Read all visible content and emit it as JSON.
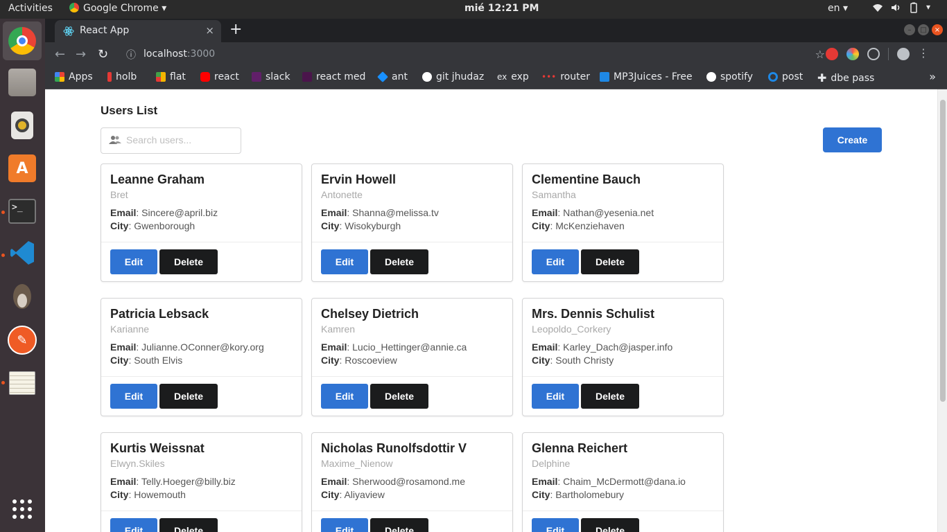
{
  "system": {
    "activities": "Activities",
    "app_menu": "Google Chrome",
    "clock": "mié 12:21 PM",
    "language": "en"
  },
  "dock": {
    "items": [
      "chrome-icon",
      "files-icon",
      "rhythmbox-icon",
      "software-center-icon",
      "terminal-icon",
      "vscode-icon",
      "gimp-icon",
      "postman-icon",
      "text-editor-icon",
      "show-apps-icon"
    ]
  },
  "browser": {
    "tab_title": "React App",
    "tab_close": "×",
    "new_tab": "+",
    "url_host": "localhost",
    "url_port": ":3000",
    "bookmarks": [
      "Apps",
      "holb",
      "flat",
      "react",
      "slack",
      "react med",
      "ant",
      "git jhudaz",
      "exp",
      "router",
      "MP3Juices - Free",
      "spotify",
      "post",
      "dbe pass"
    ],
    "bookmark_more": "»",
    "bookmark_colors": [
      "#ea4335",
      "#e53935",
      "#f4b400",
      "#ff0000",
      "#611f69",
      "#4a154b",
      "#1890ff",
      "#ffffff",
      "#9e9e9e",
      "#e53935",
      "#1e88e5",
      "#ffffff",
      "#1e88e5",
      "#ffffff"
    ]
  },
  "page": {
    "title": "Users List",
    "search_placeholder": "Search users...",
    "create_label": "Create",
    "edit_label": "Edit",
    "delete_label": "Delete",
    "email_label": "Email",
    "city_label": "City",
    "accent_color": "#2f73d3",
    "users": [
      {
        "name": "Leanne Graham",
        "username": "Bret",
        "email": "Sincere@april.biz",
        "city": "Gwenborough"
      },
      {
        "name": "Ervin Howell",
        "username": "Antonette",
        "email": "Shanna@melissa.tv",
        "city": "Wisokyburgh"
      },
      {
        "name": "Clementine Bauch",
        "username": "Samantha",
        "email": "Nathan@yesenia.net",
        "city": "McKenziehaven"
      },
      {
        "name": "Patricia Lebsack",
        "username": "Karianne",
        "email": "Julianne.OConner@kory.org",
        "city": "South Elvis"
      },
      {
        "name": "Chelsey Dietrich",
        "username": "Kamren",
        "email": "Lucio_Hettinger@annie.ca",
        "city": "Roscoeview"
      },
      {
        "name": "Mrs. Dennis Schulist",
        "username": "Leopoldo_Corkery",
        "email": "Karley_Dach@jasper.info",
        "city": "South Christy"
      },
      {
        "name": "Kurtis Weissnat",
        "username": "Elwyn.Skiles",
        "email": "Telly.Hoeger@billy.biz",
        "city": "Howemouth"
      },
      {
        "name": "Nicholas Runolfsdottir V",
        "username": "Maxime_Nienow",
        "email": "Sherwood@rosamond.me",
        "city": "Aliyaview"
      },
      {
        "name": "Glenna Reichert",
        "username": "Delphine",
        "email": "Chaim_McDermott@dana.io",
        "city": "Bartholomebury"
      }
    ]
  }
}
